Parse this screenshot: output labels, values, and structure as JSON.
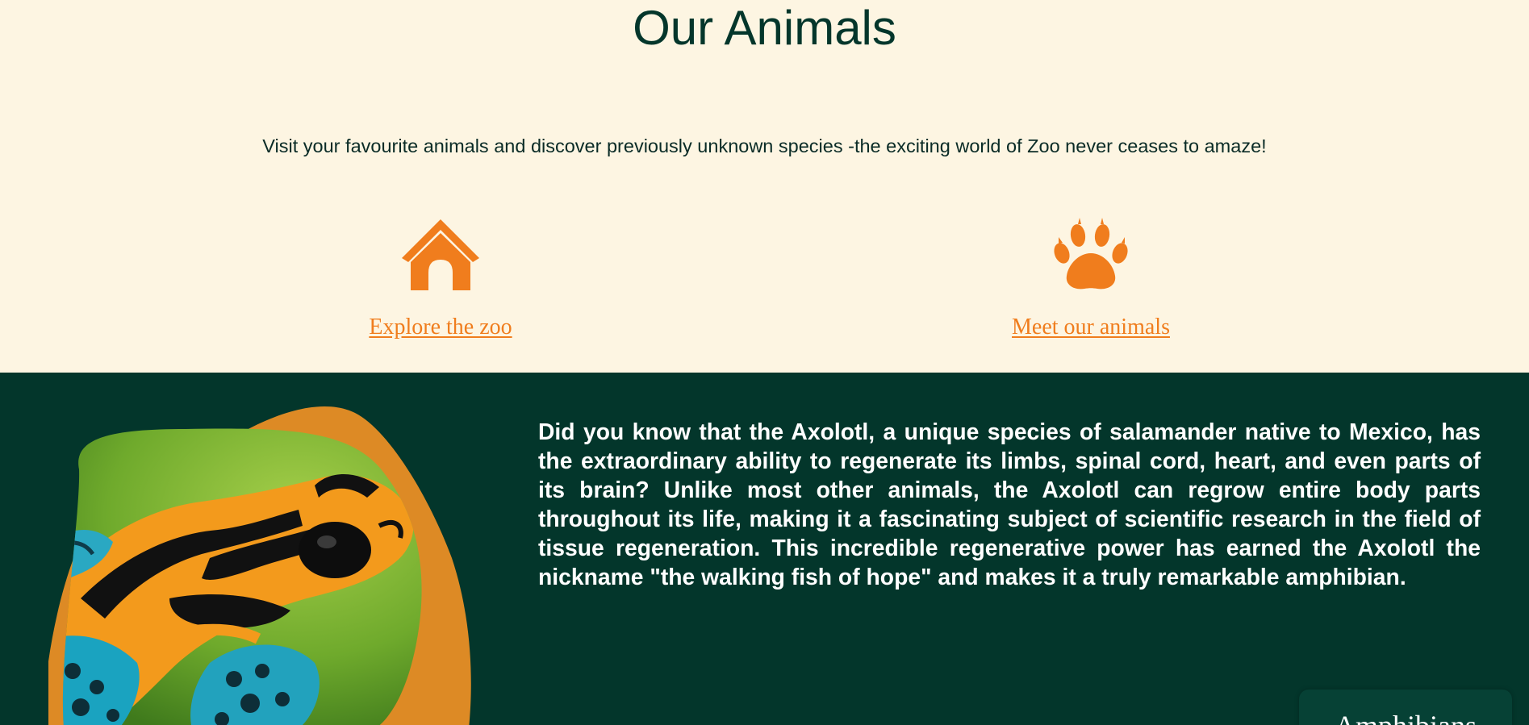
{
  "page": {
    "title": "Our Animals",
    "intro": "Visit your favourite animals and discover previously unknown species -the exciting world of Zoo never ceases to amaze!"
  },
  "features": {
    "explore": {
      "icon": "doghouse-icon",
      "label": "Explore the zoo"
    },
    "meet": {
      "icon": "paw-icon",
      "label": "Meet our animals"
    }
  },
  "fact": {
    "text": "Did you know that the Axolotl, a unique species of salamander native to Mexico, has the extraordinary ability to regenerate its limbs, spinal cord, heart, and even parts of its brain? Unlike most other animals, the Axolotl can regrow entire body parts throughout its life, making it a fascinating subject of scientific research in the field of tissue regeneration. This incredible regenerative power has earned the Axolotl the nickname \"the walking fish of hope\" and makes it a truly remarkable amphibian."
  },
  "category_tab": {
    "label": "Amphibians"
  },
  "colors": {
    "cream_background": "#fdf5e2",
    "dark_green": "#03362b",
    "accent_orange": "#f07d1d",
    "blob_orange": "#dd8a25"
  }
}
